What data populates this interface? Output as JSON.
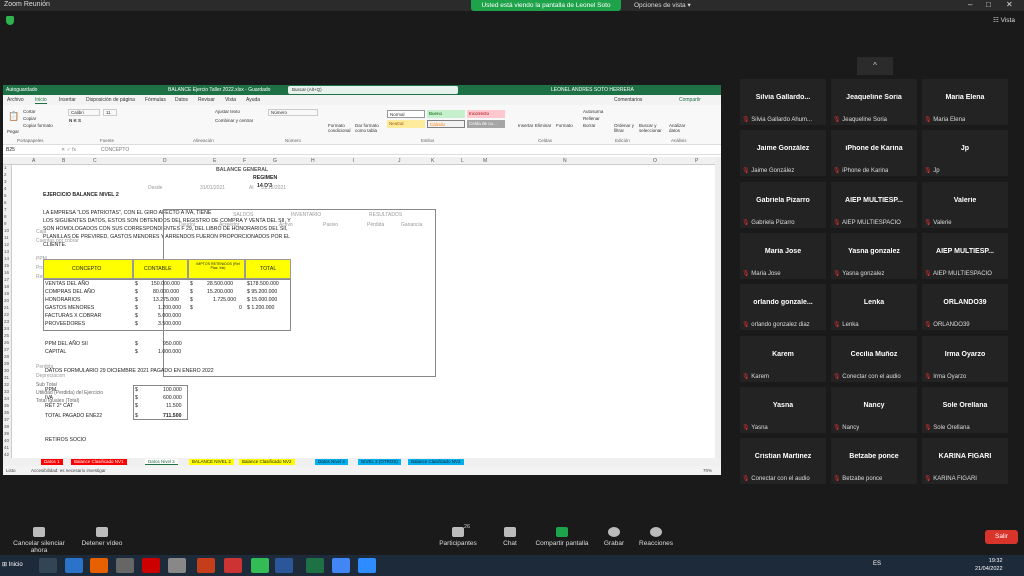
{
  "zoom": {
    "app_title": "Zoom Reunión",
    "share_banner": "Usted está viendo la pantalla de Leonel Soto",
    "view_options": "Opciones de vista",
    "view_button": "Vista",
    "collapse": "^"
  },
  "excel": {
    "title": "BALANCE Ejercio Taller 2022.xlsx - Guardado",
    "autosave": "Autoguardado",
    "search_placeholder": "Buscar (Alt+Q)",
    "user": "LEONEL ANDRES SOTO HERRERA",
    "tabs": [
      "Archivo",
      "Inicio",
      "Insertar",
      "Disposición de página",
      "Fórmulas",
      "Datos",
      "Revisar",
      "Vista",
      "Ayuda"
    ],
    "comments": "Comentarios",
    "share": "Compartir",
    "ribbon": {
      "paste": "Pegar",
      "cut": "Cortar",
      "copy": "Copiar",
      "format_painter": "Copiar formato",
      "clipboard": "Portapapeles",
      "font_name": "Calibri",
      "font_size": "11",
      "font": "Fuente",
      "wrap": "Ajustar texto",
      "merge": "Combinar y centrar",
      "alignment": "Alineación",
      "number_format": "Número",
      "number": "Número",
      "conditional": "Formato condicional",
      "as_table": "Dar formato como tabla",
      "styles": [
        "Normal",
        "Bueno",
        "Incorrecto",
        "Neutral",
        "Cálculo",
        "Celda de co..."
      ],
      "styles_group": "Estilos",
      "insert": "Insertar",
      "delete": "Eliminar",
      "format": "Formato",
      "cells": "Celdas",
      "autosum": "Autosuma",
      "fill": "Rellenar",
      "clear": "Borrar",
      "sort": "Ordenar y filtrar",
      "find": "Buscar y seleccionar",
      "editing": "Edición",
      "analyze": "Analizar datos",
      "analysis": "Análisis"
    },
    "name_box": "B25",
    "formula_value": "CONCEPTO",
    "columns": [
      "A",
      "B",
      "C",
      "D",
      "E",
      "F",
      "G",
      "H",
      "I",
      "J",
      "K",
      "L",
      "M",
      "N",
      "O",
      "P"
    ],
    "rows": [
      "1",
      "2",
      "3",
      "4",
      "5",
      "6",
      "7",
      "8",
      "9",
      "10",
      "11",
      "12",
      "13",
      "14",
      "15",
      "16",
      "17",
      "18",
      "19",
      "20",
      "21",
      "22",
      "23",
      "24",
      "25",
      "26",
      "27",
      "28",
      "29",
      "30",
      "31",
      "32",
      "33",
      "34",
      "35",
      "36",
      "37",
      "38",
      "39",
      "40",
      "41",
      "42"
    ],
    "sheet": {
      "header": "BALANCE GENERAL",
      "regimen": "REGIMEN",
      "regimen_value": "14 D'3",
      "desde_label": "Desde",
      "desde": "31/01/2021",
      "al_label": "Al",
      "al": "31/12/2021",
      "exercise_title": "EJERCICIO BALANCE NIVEL 2",
      "intro": [
        "LA EMPRESA \"LOS PATRIOTAS\", CON EL GIRO AFECTO A IVA, TIENE",
        "LOS SIGUIENTES DATOS, ESTOS SON OBTENIDOS DEL REGISTRO DE COMPRA Y VENTA DEL SII, Y",
        "SON HOMOLOGADOS CON SUS CORRESPONDIENTES F 29, DEL LIBRO DE HONORARIOS DEL SII,",
        "PLANILLAS DE PREVIRED, GASTOS MENORES Y ARRENDOS FUERON PROPORCIONADOS POR EL",
        "CLIENTE."
      ],
      "table_headers": {
        "concepto": "CONCEPTO",
        "contable": "CONTABLE",
        "impto": "IMPTOS RETENIDOS (Ret Plaz. Ink)",
        "total": "TOTAL"
      },
      "rows": [
        {
          "concepto": "VENTAS DEL AÑO",
          "cur": "$",
          "contable": "150.000.000",
          "cur2": "$",
          "impto": "28.500.000",
          "total": "$178.500.000"
        },
        {
          "concepto": "COMPRAS DEL AÑO",
          "cur": "$",
          "contable": "80.000.000",
          "cur2": "$",
          "impto": "15.200.000",
          "total": "$ 95.200.000"
        },
        {
          "concepto": "HONORARIOS",
          "cur": "$",
          "contable": "13.275.000",
          "cur2": "$",
          "impto": "1.725.000",
          "total": "$ 15.000.000"
        },
        {
          "concepto": "GASTOS MENORES",
          "cur": "$",
          "contable": "1.200.000",
          "cur2": "$",
          "impto": "0",
          "total": "$ 1.200.000"
        },
        {
          "concepto": "FACTURAS X COBRAR",
          "cur": "$",
          "contable": "5.000.000",
          "cur2": "",
          "impto": "",
          "total": ""
        },
        {
          "concepto": "PROVEEDORES",
          "cur": "$",
          "contable": "3.500.000",
          "cur2": "",
          "impto": "",
          "total": ""
        }
      ],
      "ppm_label": "PPM DEL AÑO SII",
      "ppm_cur": "$",
      "ppm_value": "950.000",
      "capital_label": "CAPITAL",
      "capital_cur": "$",
      "capital_value": "1.000.000",
      "f29_title": "DATOS FORMULARIO 29 DICIEMBRE 2021 PAGADO EN ENERO 2022",
      "f29_rows": [
        {
          "label": "PPM",
          "cur": "$",
          "value": "100.000"
        },
        {
          "label": "IVA",
          "cur": "$",
          "value": "600.000"
        },
        {
          "label": "RET 2° CAT",
          "cur": "$",
          "value": "11.500"
        }
      ],
      "total_label": "TOTAL PAGADO ENE22",
      "total_cur": "$",
      "total_value": "711.500",
      "retiros": "RETIROS SOCIO",
      "bg_headers": [
        "SALDOS",
        "INVENTARIO",
        "RESULTADOS"
      ],
      "bg_subheaders": [
        "Deudor",
        "Acreedor",
        "Activo",
        "Pasivo",
        "Pérdida",
        "Ganancia"
      ],
      "ghost_left": [
        "Caja",
        "Cuentas por cobrar",
        "PPM",
        "Proveedores",
        "Ret 2° Cat",
        "Iva",
        "Impuestos",
        "Capital",
        "Ventas",
        "Compras",
        "Honorarios",
        "Gastos menores",
        "Perdida",
        "Depreciacion",
        "Sub Total",
        "Utilidad (Perdida) del Ejercicio",
        "Total Iguales (Total)"
      ],
      "zeros": "0"
    },
    "sheet_tabs": [
      {
        "label": "Datos 1",
        "color": "#ff0000"
      },
      {
        "label": "Balance Clasificado NV1",
        "color": "#ff0000"
      },
      {
        "label": "Datos Nivel 2",
        "color": "#ffffff"
      },
      {
        "label": "BALANCE NIVEL 2",
        "color": "#ffff00"
      },
      {
        "label": "Balance Clasificado NV2",
        "color": "#ffff00"
      },
      {
        "label": "Datos Nivel 3",
        "color": "#00b0f0"
      },
      {
        "label": "NIVEL 3 (OTROS)",
        "color": "#00b0f0"
      },
      {
        "label": "Balance Clasificado NV3",
        "color": "#00b0f0"
      }
    ],
    "status_left": "Listo",
    "status_access": "Accesibilidad: es necesario investigar",
    "zoom_level": "70%"
  },
  "participants": [
    {
      "name": "Silvia  Gallardo...",
      "label": "Silvia Gallardo Ahum..."
    },
    {
      "name": "Jeaqueline Soria",
      "label": "Jeaqueline Soria"
    },
    {
      "name": "Maria Elena",
      "label": "Maria Elena"
    },
    {
      "name": "Jaime González",
      "label": "Jaime González"
    },
    {
      "name": "iPhone de Karina",
      "label": "iPhone de Karina"
    },
    {
      "name": "Jp",
      "label": "Jp"
    },
    {
      "name": "Gabriela Pizarro",
      "label": "Gabriela Pizarro"
    },
    {
      "name": "AIEP  MULTIESP...",
      "label": "AIEP MULTIESPACIO"
    },
    {
      "name": "Valerie",
      "label": "Valerie"
    },
    {
      "name": "Maria Jose",
      "label": "Maria Jose"
    },
    {
      "name": "Yasna gonzalez",
      "label": "Yasna gonzalez"
    },
    {
      "name": "AIEP  MULTIESP...",
      "label": "AIEP MULTIESPACIO"
    },
    {
      "name": "orlando  gonzale...",
      "label": "orlando gonzalez diaz"
    },
    {
      "name": "Lenka",
      "label": "Lenka"
    },
    {
      "name": "ORLANDO39",
      "label": "ORLANDO39"
    },
    {
      "name": "Karem",
      "label": "Karem"
    },
    {
      "name": "Cecilia Muñoz",
      "label": "Conectar con el audio"
    },
    {
      "name": "Irma Oyarzo",
      "label": "Irma Oyarzo"
    },
    {
      "name": "Yasna",
      "label": "Yasna"
    },
    {
      "name": "Nancy",
      "label": "Nancy"
    },
    {
      "name": "Sole Orellana",
      "label": "Sole Orellana"
    },
    {
      "name": "Cristian Martinez",
      "label": "Conectar con el audio"
    },
    {
      "name": "Betzabe ponce",
      "label": "Betzabe ponce"
    },
    {
      "name": "KARINA FIGARI",
      "label": "KARINA FIGARI"
    }
  ],
  "toolbar": {
    "audio": "Cancelar silenciar ahora",
    "video": "Detener vídeo",
    "participants": "Participantes",
    "participants_count": "26",
    "chat": "Chat",
    "share": "Compartir pantalla",
    "record": "Grabar",
    "reactions": "Reacciones",
    "leave": "Salir"
  },
  "taskbar": {
    "start": "Inicio",
    "lang": "ES",
    "time": "19:32",
    "date": "21/04/2022"
  }
}
